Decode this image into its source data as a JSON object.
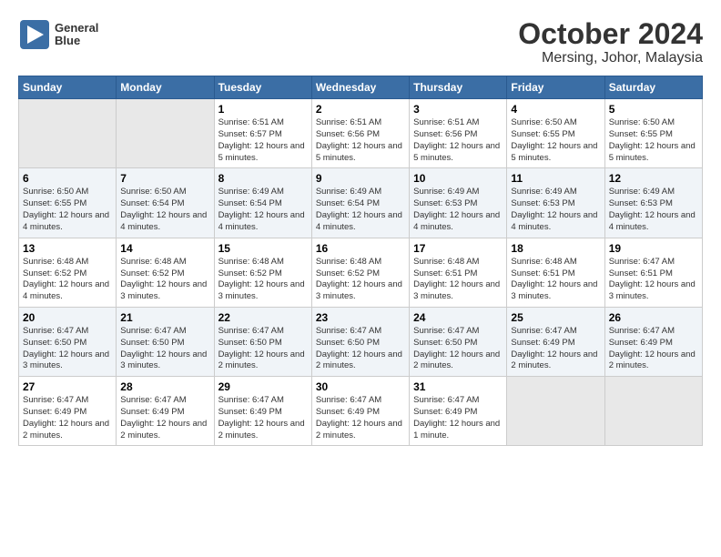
{
  "logo": {
    "line1": "General",
    "line2": "Blue"
  },
  "title": "October 2024",
  "subtitle": "Mersing, Johor, Malaysia",
  "days_of_week": [
    "Sunday",
    "Monday",
    "Tuesday",
    "Wednesday",
    "Thursday",
    "Friday",
    "Saturday"
  ],
  "weeks": [
    [
      {
        "day": "",
        "info": ""
      },
      {
        "day": "",
        "info": ""
      },
      {
        "day": "1",
        "info": "Sunrise: 6:51 AM\nSunset: 6:57 PM\nDaylight: 12 hours and 5 minutes."
      },
      {
        "day": "2",
        "info": "Sunrise: 6:51 AM\nSunset: 6:56 PM\nDaylight: 12 hours and 5 minutes."
      },
      {
        "day": "3",
        "info": "Sunrise: 6:51 AM\nSunset: 6:56 PM\nDaylight: 12 hours and 5 minutes."
      },
      {
        "day": "4",
        "info": "Sunrise: 6:50 AM\nSunset: 6:55 PM\nDaylight: 12 hours and 5 minutes."
      },
      {
        "day": "5",
        "info": "Sunrise: 6:50 AM\nSunset: 6:55 PM\nDaylight: 12 hours and 5 minutes."
      }
    ],
    [
      {
        "day": "6",
        "info": "Sunrise: 6:50 AM\nSunset: 6:55 PM\nDaylight: 12 hours and 4 minutes."
      },
      {
        "day": "7",
        "info": "Sunrise: 6:50 AM\nSunset: 6:54 PM\nDaylight: 12 hours and 4 minutes."
      },
      {
        "day": "8",
        "info": "Sunrise: 6:49 AM\nSunset: 6:54 PM\nDaylight: 12 hours and 4 minutes."
      },
      {
        "day": "9",
        "info": "Sunrise: 6:49 AM\nSunset: 6:54 PM\nDaylight: 12 hours and 4 minutes."
      },
      {
        "day": "10",
        "info": "Sunrise: 6:49 AM\nSunset: 6:53 PM\nDaylight: 12 hours and 4 minutes."
      },
      {
        "day": "11",
        "info": "Sunrise: 6:49 AM\nSunset: 6:53 PM\nDaylight: 12 hours and 4 minutes."
      },
      {
        "day": "12",
        "info": "Sunrise: 6:49 AM\nSunset: 6:53 PM\nDaylight: 12 hours and 4 minutes."
      }
    ],
    [
      {
        "day": "13",
        "info": "Sunrise: 6:48 AM\nSunset: 6:52 PM\nDaylight: 12 hours and 4 minutes."
      },
      {
        "day": "14",
        "info": "Sunrise: 6:48 AM\nSunset: 6:52 PM\nDaylight: 12 hours and 3 minutes."
      },
      {
        "day": "15",
        "info": "Sunrise: 6:48 AM\nSunset: 6:52 PM\nDaylight: 12 hours and 3 minutes."
      },
      {
        "day": "16",
        "info": "Sunrise: 6:48 AM\nSunset: 6:52 PM\nDaylight: 12 hours and 3 minutes."
      },
      {
        "day": "17",
        "info": "Sunrise: 6:48 AM\nSunset: 6:51 PM\nDaylight: 12 hours and 3 minutes."
      },
      {
        "day": "18",
        "info": "Sunrise: 6:48 AM\nSunset: 6:51 PM\nDaylight: 12 hours and 3 minutes."
      },
      {
        "day": "19",
        "info": "Sunrise: 6:47 AM\nSunset: 6:51 PM\nDaylight: 12 hours and 3 minutes."
      }
    ],
    [
      {
        "day": "20",
        "info": "Sunrise: 6:47 AM\nSunset: 6:50 PM\nDaylight: 12 hours and 3 minutes."
      },
      {
        "day": "21",
        "info": "Sunrise: 6:47 AM\nSunset: 6:50 PM\nDaylight: 12 hours and 3 minutes."
      },
      {
        "day": "22",
        "info": "Sunrise: 6:47 AM\nSunset: 6:50 PM\nDaylight: 12 hours and 2 minutes."
      },
      {
        "day": "23",
        "info": "Sunrise: 6:47 AM\nSunset: 6:50 PM\nDaylight: 12 hours and 2 minutes."
      },
      {
        "day": "24",
        "info": "Sunrise: 6:47 AM\nSunset: 6:50 PM\nDaylight: 12 hours and 2 minutes."
      },
      {
        "day": "25",
        "info": "Sunrise: 6:47 AM\nSunset: 6:49 PM\nDaylight: 12 hours and 2 minutes."
      },
      {
        "day": "26",
        "info": "Sunrise: 6:47 AM\nSunset: 6:49 PM\nDaylight: 12 hours and 2 minutes."
      }
    ],
    [
      {
        "day": "27",
        "info": "Sunrise: 6:47 AM\nSunset: 6:49 PM\nDaylight: 12 hours and 2 minutes."
      },
      {
        "day": "28",
        "info": "Sunrise: 6:47 AM\nSunset: 6:49 PM\nDaylight: 12 hours and 2 minutes."
      },
      {
        "day": "29",
        "info": "Sunrise: 6:47 AM\nSunset: 6:49 PM\nDaylight: 12 hours and 2 minutes."
      },
      {
        "day": "30",
        "info": "Sunrise: 6:47 AM\nSunset: 6:49 PM\nDaylight: 12 hours and 2 minutes."
      },
      {
        "day": "31",
        "info": "Sunrise: 6:47 AM\nSunset: 6:49 PM\nDaylight: 12 hours and 1 minute."
      },
      {
        "day": "",
        "info": ""
      },
      {
        "day": "",
        "info": ""
      }
    ]
  ]
}
